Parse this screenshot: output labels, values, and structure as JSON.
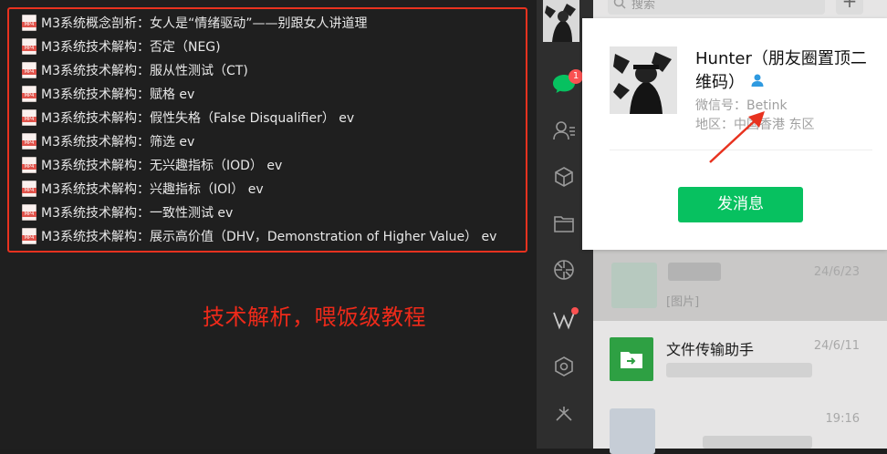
{
  "files": [
    {
      "name": "M3系统概念剖析：女人是“情绪驱动”——别跟女人讲道理",
      "icon": "mp4-file-icon"
    },
    {
      "name": "M3系统技术解构：否定（NEG)",
      "icon": "mp4-file-icon"
    },
    {
      "name": "M3系统技术解构：服从性测试（CT)",
      "icon": "mp4-file-icon"
    },
    {
      "name": "M3系统技术解构：赋格  ev",
      "icon": "mp4-file-icon"
    },
    {
      "name": "M3系统技术解构：假性失格（False Disqualifier）  ev",
      "icon": "mp4-file-icon"
    },
    {
      "name": "M3系统技术解构：筛选  ev",
      "icon": "mp4-file-icon"
    },
    {
      "name": "M3系统技术解构：无兴趣指标（IOD）  ev",
      "icon": "mp4-file-icon"
    },
    {
      "name": "M3系统技术解构：兴趣指标（IOI）  ev",
      "icon": "mp4-file-icon"
    },
    {
      "name": "M3系统技术解构：一致性测试  ev",
      "icon": "mp4-file-icon"
    },
    {
      "name": "M3系统技术解构：展示高价值（DHV，Demonstration of Higher Value）  ev",
      "icon": "mp4-file-icon"
    }
  ],
  "annotation": "技术解析，喂饭级教程",
  "sidebar": {
    "chat_badge": "1",
    "icons": [
      "chat-icon",
      "contacts-icon",
      "favorites-box-icon",
      "folder-icon",
      "moments-icon",
      "channels-icon",
      "miniprogram-icon",
      "more-icon"
    ]
  },
  "search": {
    "placeholder": "搜索",
    "plus_label": "+"
  },
  "chats": [
    {
      "name": "",
      "time": "24/6/23",
      "preview": "[图片]"
    },
    {
      "name": "文件传输助手",
      "time": "24/6/11",
      "preview": ""
    },
    {
      "name": "",
      "time": "19:16",
      "preview": ""
    }
  ],
  "profile": {
    "name": "Hunter（朋友圈置顶二维码）",
    "wechat_id_label": "微信号：",
    "wechat_id": "Betink",
    "region_label": "地区：",
    "region": "中国香港 东区",
    "send_button": "发消息"
  },
  "colors": {
    "accent_green": "#07c160",
    "highlight_red": "#e8321f",
    "badge_red": "#fa5151"
  }
}
